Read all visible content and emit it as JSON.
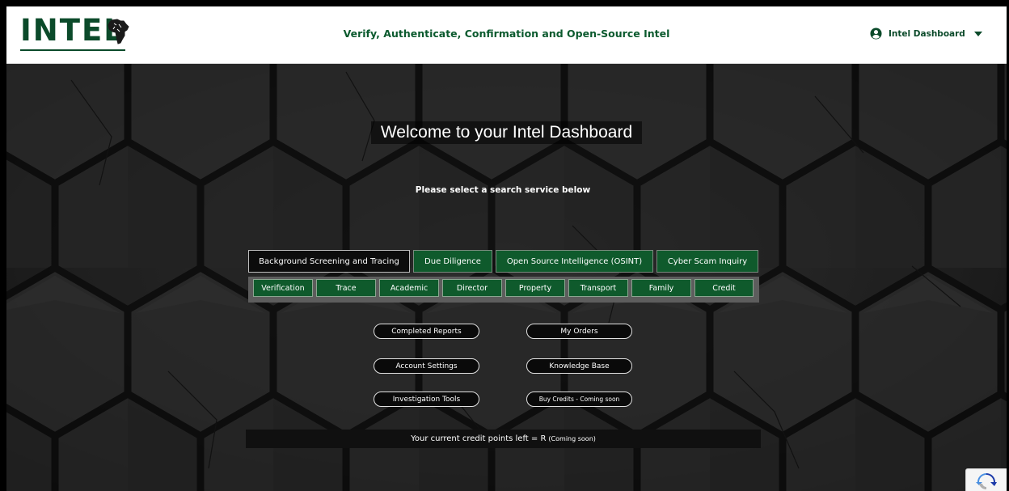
{
  "header": {
    "logo_text": "INTEL",
    "tagline": "Verify, Authenticate, Confirmation and Open-Source Intel",
    "user_menu_label": "Intel Dashboard"
  },
  "main": {
    "welcome": "Welcome to your Intel Dashboard",
    "subtitle": "Please select a search service below"
  },
  "tabs": [
    {
      "label": "Background Screening and Tracing",
      "active": true
    },
    {
      "label": "Due Diligence",
      "active": false
    },
    {
      "label": "Open Source Intelligence (OSINT)",
      "active": false
    },
    {
      "label": "Cyber Scam Inquiry",
      "active": false
    }
  ],
  "subtabs": [
    "Verification",
    "Trace",
    "Academic",
    "Director",
    "Property",
    "Transport",
    "Family",
    "Credit"
  ],
  "links": {
    "completed_reports": "Completed Reports",
    "my_orders": "My Orders",
    "account_settings": "Account Settings",
    "knowledge_base": "Knowledge Base",
    "investigation_tools": "Investigation Tools",
    "buy_credits": "Buy Credits - Coming soon"
  },
  "credits": {
    "text": "Your current credit points left = R",
    "note": "(Coming soon)"
  },
  "colors": {
    "brand_green": "#0b4a2a",
    "tab_green": "#0f5a2c",
    "active_tab": "#0c0c0c"
  },
  "icons": {
    "user": "user-circle-icon",
    "dropdown": "caret-down-icon",
    "logo_mark": "africa-map-icon",
    "recaptcha": "recaptcha-icon"
  }
}
